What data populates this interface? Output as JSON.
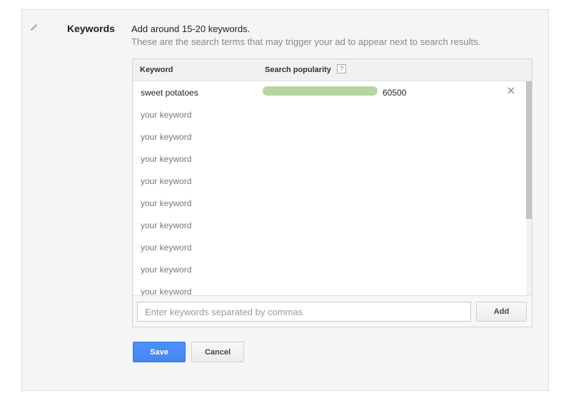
{
  "section": {
    "title": "Keywords",
    "instruction": "Add around 15-20 keywords.",
    "subinstruction": "These are the search terms that may trigger your ad to appear next to search results."
  },
  "table": {
    "col_keyword": "Keyword",
    "col_popularity": "Search popularity",
    "help_glyph": "?",
    "rows": [
      {
        "keyword": "sweet potatoes",
        "popularity": "60500",
        "popularity_fraction": 1.0
      },
      {
        "placeholder": "your keyword"
      },
      {
        "placeholder": "your keyword"
      },
      {
        "placeholder": "your keyword"
      },
      {
        "placeholder": "your keyword"
      },
      {
        "placeholder": "your keyword"
      },
      {
        "placeholder": "your keyword"
      },
      {
        "placeholder": "your keyword"
      },
      {
        "placeholder": "your keyword"
      },
      {
        "placeholder": "your keyword"
      }
    ]
  },
  "input": {
    "placeholder": "Enter keywords separated by commas",
    "value": ""
  },
  "buttons": {
    "add": "Add",
    "save": "Save",
    "cancel": "Cancel"
  },
  "colors": {
    "popularity_bar": "#b6d6a1",
    "save_button": "#4d90fe"
  },
  "icons": {
    "edit": "pencil-icon",
    "remove": "close-icon",
    "help": "help-icon"
  }
}
